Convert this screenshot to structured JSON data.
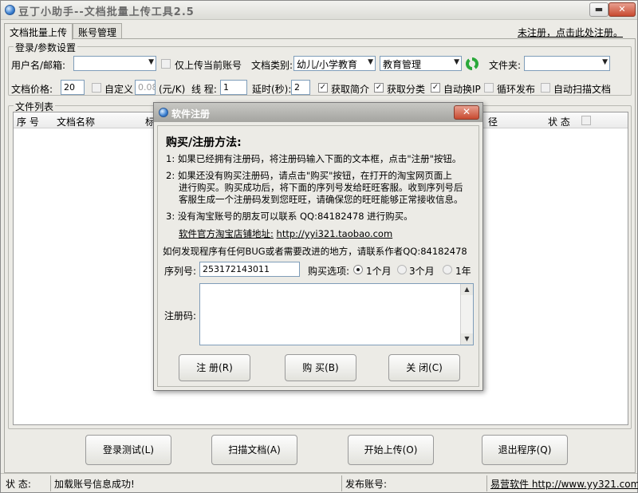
{
  "window": {
    "title": "豆丁小助手--文档批量上传工具2.5",
    "min_label": "▬",
    "close_label": "✕"
  },
  "tabs": [
    {
      "label": "文档批量上传",
      "active": true
    },
    {
      "label": "账号管理",
      "active": false
    }
  ],
  "register_link": "未注册，点击此处注册。",
  "login_group": {
    "legend": "登录/参数设置",
    "username_label": "用户名/邮箱:",
    "username_value": "",
    "upload_current_label": "仅上传当前账号",
    "doc_category_label": "文档类别:",
    "category1": "幼儿/小学教育",
    "category2": "教育管理",
    "folder_label": "文件夹:",
    "folder_value": "",
    "price_label": "文档价格:",
    "price_value": "20",
    "custom_label": "自定义",
    "custom_value": "0.08",
    "unit_label": "(元/K)",
    "threads_label": "线 程:",
    "threads_value": "1",
    "delay_label": "延时(秒):",
    "delay_value": "2",
    "get_summary_label": "获取简介",
    "get_category_label": "获取分类",
    "auto_ip_label": "自动换IP",
    "loop_label": "循环发布",
    "auto_scan_label": "自动扫描文档"
  },
  "file_list": {
    "legend": "文件列表",
    "columns": [
      "序 号",
      "文档名称",
      "标",
      "径",
      "状 态"
    ]
  },
  "buttons": {
    "login_test": "登录测试(L)",
    "scan_docs": "扫描文档(A)",
    "start_upload": "开始上传(O)",
    "exit": "退出程序(Q)"
  },
  "statusbar": {
    "status_label": "状 态:",
    "status_value": "加载账号信息成功!",
    "publish_label": "发布账号:",
    "publish_value": "",
    "vendor": "易营软件",
    "vendor_url": "http://www.yy321.com"
  },
  "dialog": {
    "title": "软件注册",
    "close_label": "✕",
    "heading": "购买/注册方法:",
    "line1": "1:  如果已经拥有注册码，将注册码输入下面的文本框，点击\"注册\"按钮。",
    "line2a": "2:  如果还没有购买注册码，请点击\"购买\"按钮，在打开的淘宝网页面上",
    "line2b": "进行购买。购买成功后，将下面的序列号发给旺旺客服。收到序列号后",
    "line2c": "客服生成一个注册码发到您旺旺，请确保您的旺旺能够正常接收信息。",
    "line3": "3:  没有淘宝账号的朋友可以联系 QQ:84182478 进行购买。",
    "shop_label": "软件官方淘宝店铺地址:",
    "shop_url": "http://yyi321.taobao.com",
    "bug_line": "如何发现程序有任何BUG或者需要改进的地方，请联系作者QQ:84182478",
    "serial_label": "序列号:",
    "serial_value": "253172143011",
    "purchase_label": "购买选项:",
    "option1": "1个月",
    "option2": "3个月",
    "option3": "1年",
    "regcode_label": "注册码:",
    "regcode_value": "",
    "btn_register": "注    册(R)",
    "btn_buy": "购    买(B)",
    "btn_close": "关    闭(C)"
  }
}
